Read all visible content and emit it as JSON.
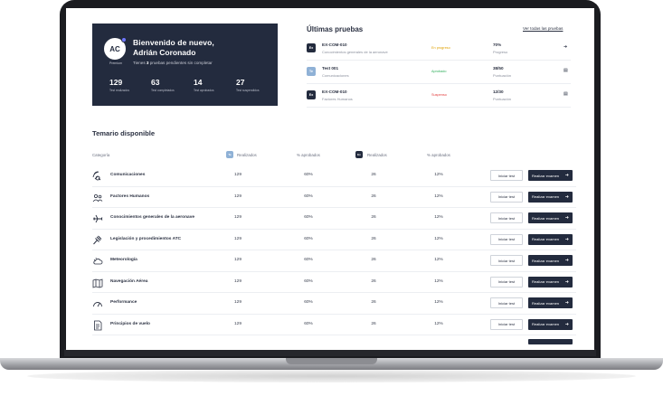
{
  "welcome": {
    "avatar_initials": "AC",
    "plan": "Premium",
    "greeting_line1": "Bienvenido de nuevo,",
    "greeting_line2": "Adrián Coronado",
    "pending_prefix": "Tienes ",
    "pending_count": "3",
    "pending_suffix": " pruebas pendientes sin completar",
    "stats": [
      {
        "value": "129",
        "label": "Test realizados"
      },
      {
        "value": "63",
        "label": "Test completados"
      },
      {
        "value": "14",
        "label": "Test aprobados"
      },
      {
        "value": "27",
        "label": "Test suspendidos"
      }
    ]
  },
  "last_tests": {
    "title": "Últimas pruebas",
    "view_all": "Ver todas las pruebas",
    "items": [
      {
        "badge": "Ex",
        "badge_color": "#232b3e",
        "name": "EX-COM-010",
        "subtitle": "Conocimientos generales de la aeronave",
        "status": "En progreso",
        "status_color": "#e0a100",
        "score": "70%",
        "score_label": "Progreso",
        "action_icon": "arrow-right-icon",
        "action_glyph": "➜"
      },
      {
        "badge": "Te",
        "badge_color": "#8fb1d6",
        "name": "Test 001",
        "subtitle": "Comunicaciones",
        "status": "Aprobado",
        "status_color": "#2fae5b",
        "score": "38/50",
        "score_label": "Puntuación",
        "action_icon": "document-icon",
        "action_glyph": "▤"
      },
      {
        "badge": "Ex",
        "badge_color": "#232b3e",
        "name": "EX-COM-010",
        "subtitle": "Factores Humanos",
        "status": "Suspenso",
        "status_color": "#e23c3c",
        "score": "12/30",
        "score_label": "Puntuación",
        "action_icon": "document-icon",
        "action_glyph": "▤"
      }
    ]
  },
  "syllabus": {
    "title": "Temario disponible",
    "headers": {
      "category": "Categoría",
      "te_badge": "Te",
      "done": "Realizados",
      "approved_pct": "% aprobados",
      "ex_badge": "Ex",
      "done2": "Realizados",
      "approved_pct2": "% aprobados"
    },
    "start_test_label": "Iniciar test",
    "exam_label": "Realizar examen",
    "rows": [
      {
        "icon": "radio-signal-icon",
        "name": "Comunicaciones",
        "te_done": "129",
        "te_pct": "60%",
        "ex_done": "26",
        "ex_pct": "12%"
      },
      {
        "icon": "people-icon",
        "name": "Factores Humanos",
        "te_done": "129",
        "te_pct": "60%",
        "ex_done": "26",
        "ex_pct": "12%"
      },
      {
        "icon": "airplane-icon",
        "name": "Conocimientos generales de la aeronave",
        "te_done": "129",
        "te_pct": "60%",
        "ex_done": "26",
        "ex_pct": "12%"
      },
      {
        "icon": "gavel-icon",
        "name": "Legislación y procedimientos ATC",
        "te_done": "129",
        "te_pct": "60%",
        "ex_done": "26",
        "ex_pct": "12%"
      },
      {
        "icon": "weather-icon",
        "name": "Meteorología",
        "te_done": "129",
        "te_pct": "60%",
        "ex_done": "26",
        "ex_pct": "12%"
      },
      {
        "icon": "map-icon",
        "name": "Navegación Aérea",
        "te_done": "129",
        "te_pct": "60%",
        "ex_done": "26",
        "ex_pct": "12%"
      },
      {
        "icon": "gauge-icon",
        "name": "Performance",
        "te_done": "129",
        "te_pct": "60%",
        "ex_done": "26",
        "ex_pct": "12%"
      },
      {
        "icon": "document-icon",
        "name": "Principios de vuelo",
        "te_done": "129",
        "te_pct": "60%",
        "ex_done": "26",
        "ex_pct": "12%"
      }
    ]
  }
}
